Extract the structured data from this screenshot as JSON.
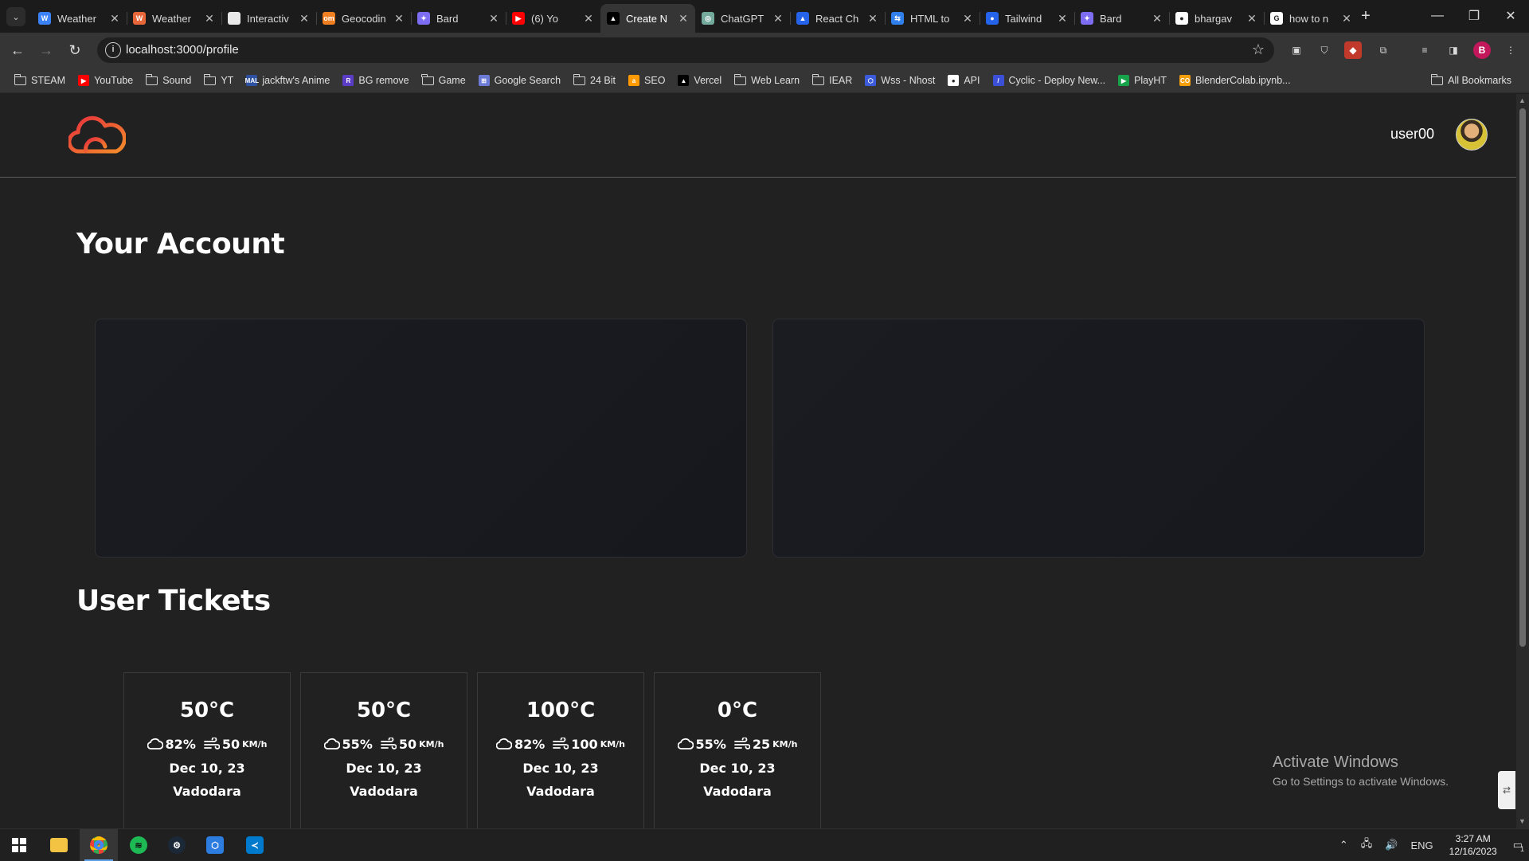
{
  "browser": {
    "tabs": [
      {
        "title": "Weather",
        "favicon": "weather-app",
        "color": "#3b82f6",
        "glyph": "W"
      },
      {
        "title": "Weather",
        "favicon": "weather-fox",
        "color": "#e8673a",
        "glyph": "W"
      },
      {
        "title": "Interactiv",
        "favicon": "page",
        "color": "#e8e8e8",
        "glyph": ""
      },
      {
        "title": "Geocodin",
        "favicon": "opencage",
        "color": "#f07f22",
        "glyph": "om"
      },
      {
        "title": "Bard",
        "favicon": "bard",
        "color": "#7c6df2",
        "glyph": "✦"
      },
      {
        "title": "(6) Yo",
        "favicon": "youtube",
        "color": "#ff0000",
        "glyph": "▶"
      },
      {
        "title": "Create N",
        "favicon": "vercel",
        "color": "#000000",
        "glyph": "▲",
        "active": true
      },
      {
        "title": "ChatGPT",
        "favicon": "chatgpt",
        "color": "#74aa9c",
        "glyph": "◎"
      },
      {
        "title": "React Ch",
        "favicon": "react-chart",
        "color": "#2563eb",
        "glyph": "▲"
      },
      {
        "title": "HTML to",
        "favicon": "html-to",
        "color": "#2f80ed",
        "glyph": "⇆"
      },
      {
        "title": "Tailwind",
        "favicon": "tailwind",
        "color": "#2563eb",
        "glyph": "●"
      },
      {
        "title": "Bard",
        "favicon": "bard",
        "color": "#7c6df2",
        "glyph": "✦"
      },
      {
        "title": "bhargav",
        "favicon": "github",
        "color": "#ffffff",
        "glyph": "●"
      },
      {
        "title": "how to n",
        "favicon": "google",
        "color": "#ffffff",
        "glyph": "G"
      }
    ],
    "url": "localhost:3000/profile",
    "bookmarks": [
      {
        "label": "STEAM",
        "type": "folder"
      },
      {
        "label": "YouTube",
        "type": "link",
        "color": "#ff0000",
        "glyph": "▶"
      },
      {
        "label": "Sound",
        "type": "folder"
      },
      {
        "label": "YT",
        "type": "folder"
      },
      {
        "label": "jackftw's Anime",
        "type": "link",
        "color": "#2e51a2",
        "glyph": "MAL"
      },
      {
        "label": "BG remove",
        "type": "link",
        "color": "#5b3cc4",
        "glyph": "R"
      },
      {
        "label": "Game",
        "type": "folder"
      },
      {
        "label": "Google Search",
        "type": "link",
        "color": "#6b7bd6",
        "glyph": "⊞"
      },
      {
        "label": "24 Bit",
        "type": "folder"
      },
      {
        "label": "SEO",
        "type": "link",
        "color": "#ff9900",
        "glyph": "a"
      },
      {
        "label": "Vercel",
        "type": "link",
        "color": "#000000",
        "glyph": "▲"
      },
      {
        "label": "Web Learn",
        "type": "folder"
      },
      {
        "label": "IEAR",
        "type": "folder"
      },
      {
        "label": "Wss - Nhost",
        "type": "link",
        "color": "#3b5bdb",
        "glyph": "⬡"
      },
      {
        "label": "API",
        "type": "link",
        "color": "#ffffff",
        "glyph": "●"
      },
      {
        "label": "Cyclic - Deploy New...",
        "type": "link",
        "color": "#3b50d6",
        "glyph": "/"
      },
      {
        "label": "PlayHT",
        "type": "link",
        "color": "#16a34a",
        "glyph": "▶"
      },
      {
        "label": "BlenderColab.ipynb...",
        "type": "link",
        "color": "#f59e0b",
        "glyph": "CO"
      }
    ],
    "all_bookmarks": "All Bookmarks",
    "profile_initial": "B"
  },
  "site": {
    "username": "user00",
    "account_title": "Your Account",
    "tickets_title": "User Tickets",
    "tickets": [
      {
        "temp": "50°C",
        "humidity": "82%",
        "wind": "50",
        "wind_unit": "KM/h",
        "date": "Dec 10, 23",
        "city": "Vadodara"
      },
      {
        "temp": "50°C",
        "humidity": "55%",
        "wind": "50",
        "wind_unit": "KM/h",
        "date": "Dec 10, 23",
        "city": "Vadodara"
      },
      {
        "temp": "100°C",
        "humidity": "82%",
        "wind": "100",
        "wind_unit": "KM/h",
        "date": "Dec 10, 23",
        "city": "Vadodara"
      },
      {
        "temp": "0°C",
        "humidity": "55%",
        "wind": "25",
        "wind_unit": "KM/h",
        "date": "Dec 10, 23",
        "city": "Vadodara"
      }
    ],
    "logo_colors": [
      "#e8303d",
      "#f28c2a"
    ]
  },
  "os": {
    "watermark_title": "Activate Windows",
    "watermark_sub": "Go to Settings to activate Windows.",
    "language": "ENG",
    "time": "3:27 AM",
    "date": "12/16/2023",
    "notification_count": "1"
  }
}
